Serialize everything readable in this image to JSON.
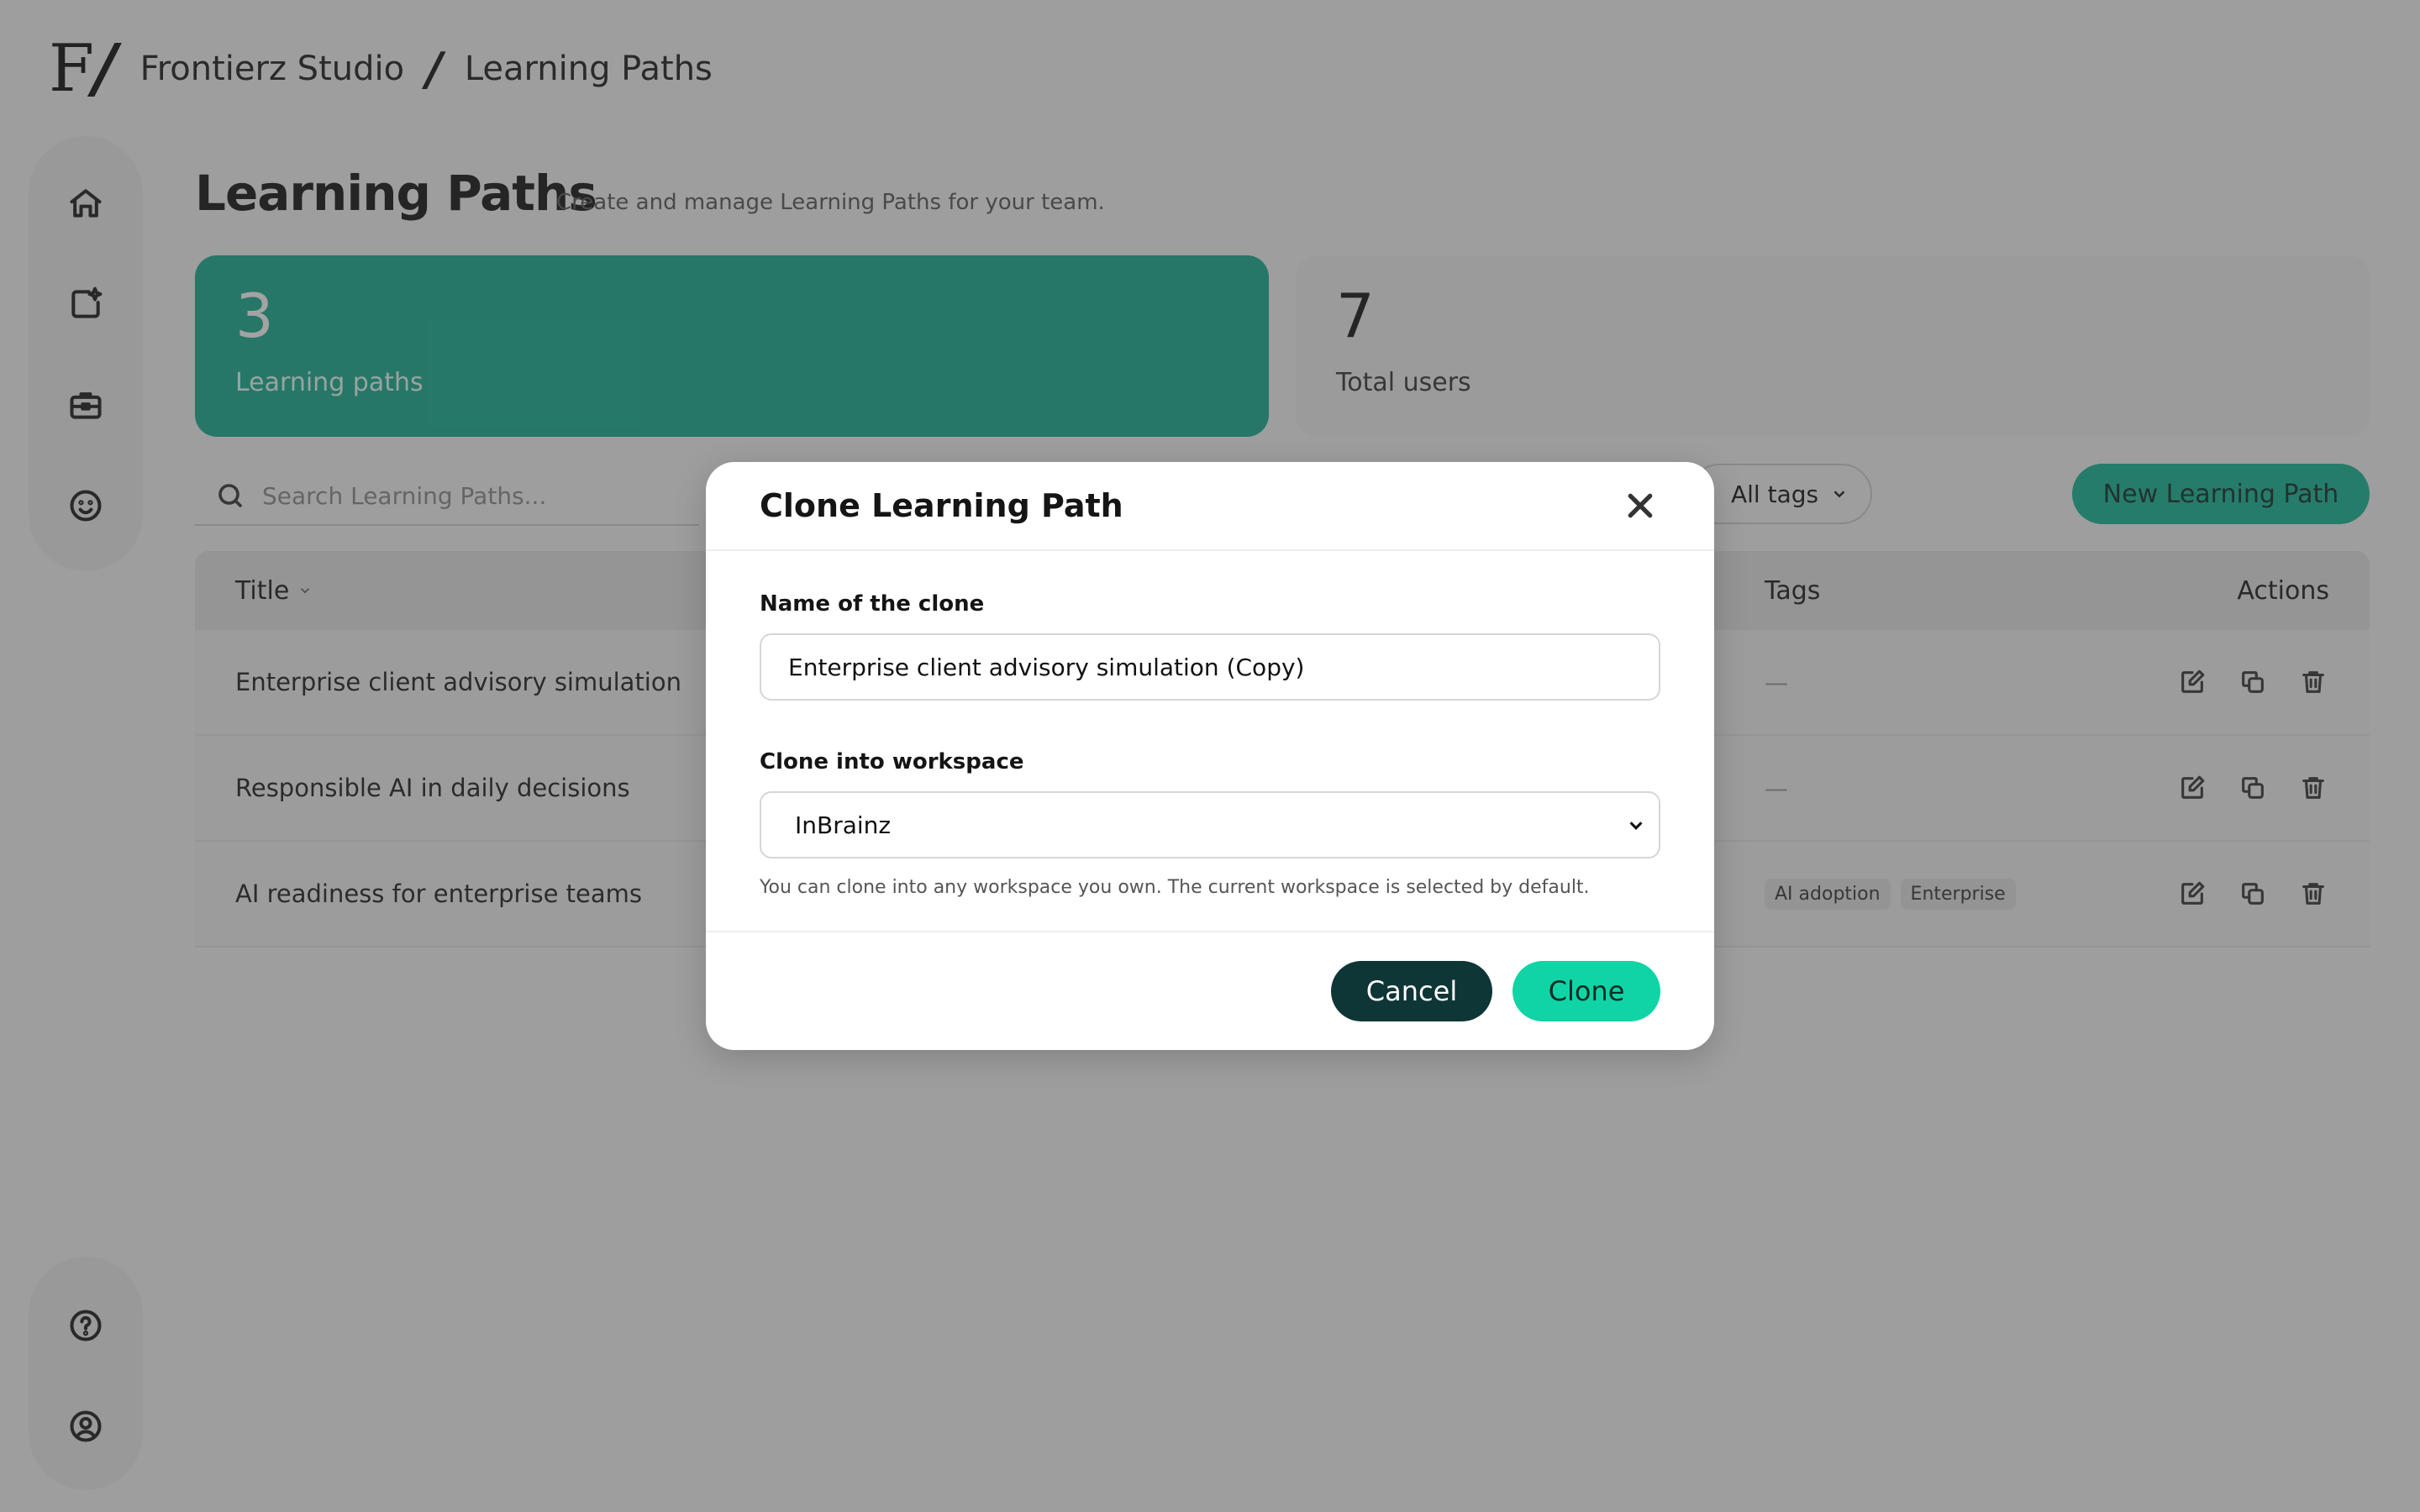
{
  "header": {
    "logo_text": "F",
    "logo_slash": "/",
    "workspace": "Frontierz Studio",
    "separator": "/",
    "section": "Learning Paths"
  },
  "page": {
    "title": "Learning Paths",
    "subtitle": "Create and manage Learning Paths for your team."
  },
  "stats": [
    {
      "value": "3",
      "label": "Learning paths"
    },
    {
      "value": "7",
      "label": "Total users"
    }
  ],
  "search": {
    "placeholder": "Search Learning Paths..."
  },
  "filters": {
    "tags_label": "All tags"
  },
  "toolbar": {
    "new_label": "New Learning Path"
  },
  "table": {
    "headers": {
      "title": "Title",
      "tags": "Tags",
      "actions": "Actions"
    },
    "rows": [
      {
        "title": "Enterprise client advisory simulation",
        "tags": [
          "—"
        ]
      },
      {
        "title": "Responsible AI in daily decisions",
        "tags": [
          "—"
        ]
      },
      {
        "title": "AI readiness for enterprise teams",
        "tags": [
          "AI adoption",
          "Enterprise"
        ]
      }
    ]
  },
  "modal": {
    "title": "Clone Learning Path",
    "name_label": "Name of the clone",
    "name_value": "Enterprise client advisory simulation (Copy)",
    "workspace_label": "Clone into workspace",
    "workspace_value": "InBrainz",
    "hint": "You can clone into any workspace you own. The current workspace is selected by default.",
    "cancel_label": "Cancel",
    "clone_label": "Clone"
  },
  "colors": {
    "accent": "#13ad8f",
    "clone_button": "#10d4a6",
    "cancel_button": "#0f3636"
  },
  "icons": {
    "sidebar_top": [
      "home-icon",
      "new-document-sparkle-icon",
      "briefcase-icon",
      "smiley-icon"
    ],
    "sidebar_bottom": [
      "help-icon",
      "user-circle-icon"
    ],
    "row_actions": [
      "edit-icon",
      "duplicate-icon",
      "trash-icon"
    ]
  }
}
